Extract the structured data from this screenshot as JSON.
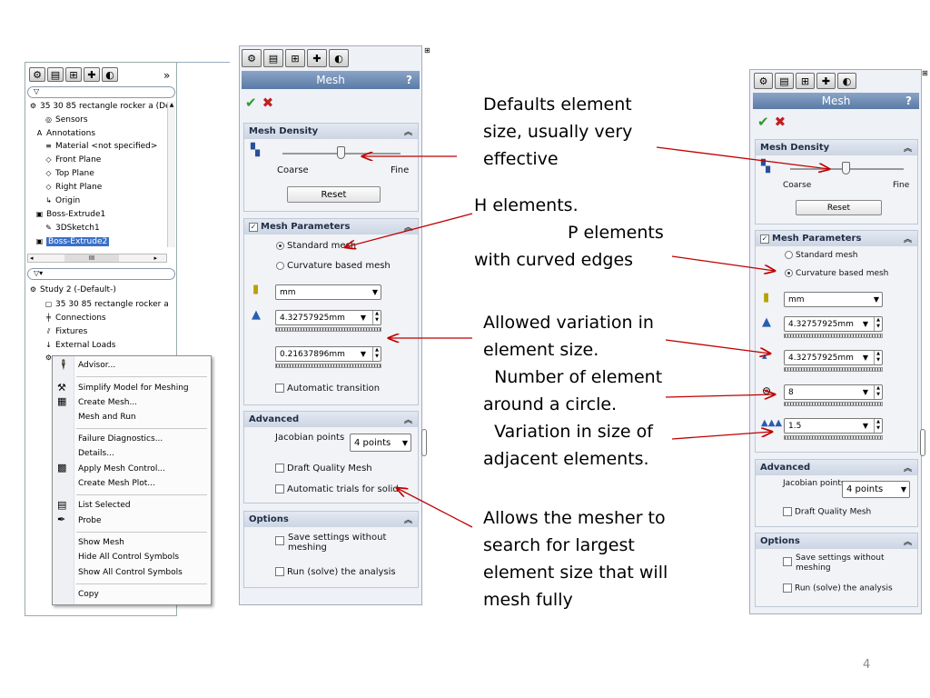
{
  "left_tree": {
    "tabs_more": "»",
    "items": [
      "35 30 85 rectangle rocker a (De",
      "Sensors",
      "Annotations",
      "Material <not specified>",
      "Front Plane",
      "Top Plane",
      "Right Plane",
      "Origin",
      "Boss-Extrude1",
      "3DSketch1",
      "Boss-Extrude2"
    ],
    "scroll_value": "III",
    "study_items": [
      "Study 2 (-Default-)",
      "35 30 85 rectangle rocker a",
      "Connections",
      "Fixtures",
      "External Loads"
    ]
  },
  "context_menu": {
    "items": [
      "Advisor...",
      "Simplify Model for Meshing",
      "Create Mesh...",
      "Mesh and Run",
      "Failure Diagnostics...",
      "Details...",
      "Apply Mesh Control...",
      "Create Mesh Plot...",
      "List Selected",
      "Probe",
      "Show Mesh",
      "Hide All Control Symbols",
      "Show All Control Symbols",
      "Copy"
    ]
  },
  "mid_panel": {
    "title": "Mesh",
    "help": "?",
    "density_header": "Mesh Density",
    "coarse": "Coarse",
    "fine": "Fine",
    "reset": "Reset",
    "params_header": "Mesh Parameters",
    "standard_mesh": "Standard mesh",
    "curvature_mesh": "Curvature based mesh",
    "unit": "mm",
    "size_value": "4.32757925mm",
    "tolerance_value": "0.21637896mm",
    "auto_transition": "Automatic transition",
    "advanced_header": "Advanced",
    "jacobian_label": "Jacobian points",
    "jacobian_value": "4 points",
    "draft_quality": "Draft Quality Mesh",
    "auto_trials": "Automatic trials for solid",
    "options_header": "Options",
    "save_settings": "Save settings without meshing",
    "run_solve": "Run (solve) the analysis"
  },
  "right_panel": {
    "title": "Mesh",
    "help": "?",
    "density_header": "Mesh Density",
    "coarse": "Coarse",
    "fine": "Fine",
    "reset": "Reset",
    "params_header": "Mesh Parameters",
    "standard_mesh": "Standard mesh",
    "curvature_mesh": "Curvature based mesh",
    "unit": "mm",
    "max_size": "4.32757925mm",
    "min_size": "4.32757925mm",
    "circle_count": "8",
    "growth_ratio": "1.5",
    "advanced_header": "Advanced",
    "jacobian_label": "Jacobian points",
    "jacobian_value": "4 points",
    "draft_quality": "Draft Quality Mesh",
    "options_header": "Options",
    "save_settings": "Save settings without meshing",
    "run_solve": "Run (solve) the analysis"
  },
  "annotations": {
    "defaults": "Defaults element\nsize, usually very\neffective",
    "h_elements": "H elements.",
    "p_elements": "P elements\nwith curved edges",
    "variation": "Allowed variation in\nelement size.",
    "circle": "  Number of element\naround a circle.",
    "adjacent": "  Variation in size of\nadjacent elements.",
    "mesher": "Allows the mesher to\nsearch for largest\nelement size that will\nmesh fully"
  },
  "page_number": "4",
  "colors": {
    "arrow": "#c00000",
    "title_bar": "#6a88b3",
    "group_bg": "#f1f3f7"
  }
}
